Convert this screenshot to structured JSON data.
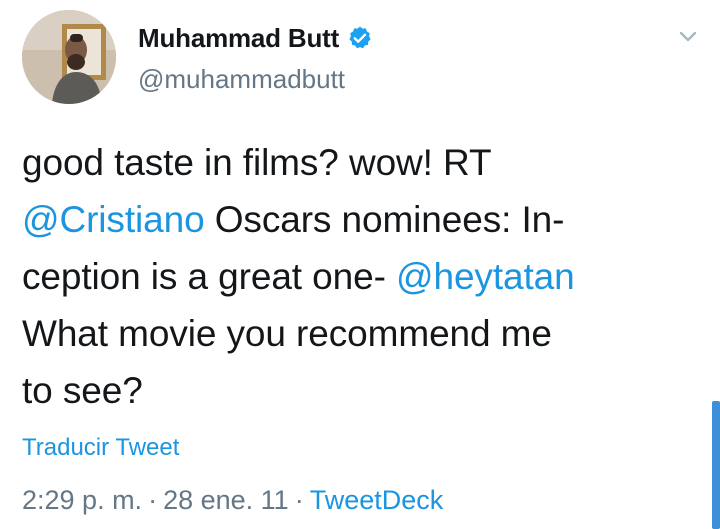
{
  "user": {
    "display_name": "Muhammad Butt",
    "handle": "@muhammadbutt",
    "verified": true
  },
  "tweet": {
    "lines": [
      [
        {
          "text": "good taste in films? wow! RT"
        }
      ],
      [
        {
          "text": "@Cristiano",
          "mention": true
        },
        {
          "text": " Oscars nominees: In-"
        }
      ],
      [
        {
          "text": "ception is a great one- "
        },
        {
          "text": "@heytatan",
          "mention": true
        }
      ],
      [
        {
          "text": "What movie you recommend me"
        }
      ],
      [
        {
          "text": "to see?"
        }
      ]
    ],
    "translate_label": "Traducir Tweet"
  },
  "meta": {
    "time": "2:29 p. m.",
    "separator": "·",
    "date": "28 ene. 11",
    "source": "TweetDeck"
  },
  "icons": {
    "avatar": "avatar-photo",
    "verified": "verified-badge-icon",
    "menu": "chevron-down-icon"
  },
  "colors": {
    "link": "#1b95e0",
    "secondary": "#657786",
    "primary_text": "#14171a",
    "verified": "#1da1f2",
    "scrollbar": "#3c8fd9"
  }
}
